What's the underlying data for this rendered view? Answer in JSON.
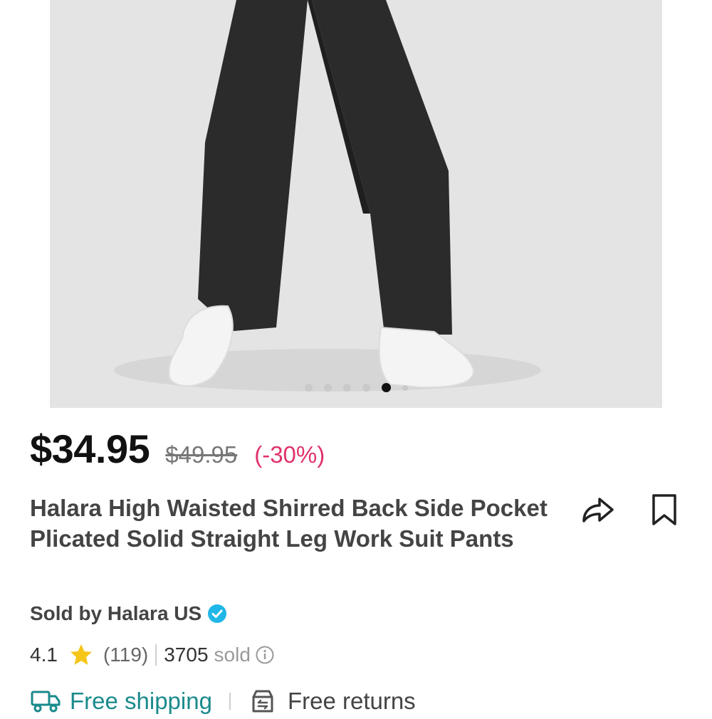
{
  "gallery": {
    "dot_count": 6,
    "active_index": 4
  },
  "price": {
    "current": "$34.95",
    "original": "$49.95",
    "discount": "(-30%)"
  },
  "product": {
    "title": "Halara High Waisted Shirred Back Side Pocket Plicated Solid Straight Leg Work Suit Pants"
  },
  "actions": {
    "share_icon": "share-icon",
    "bookmark_icon": "bookmark-icon"
  },
  "seller": {
    "label": "Sold by Halara US",
    "verified_icon": "verified-badge-icon"
  },
  "rating": {
    "score": "4.1",
    "reviews": "(119)",
    "sold_count": "3705",
    "sold_label": "sold"
  },
  "perks": {
    "shipping": "Free shipping",
    "returns": "Free returns"
  },
  "colors": {
    "discount": "#e0336a",
    "shipping": "#1a8a8c",
    "verified": "#1fb6e8",
    "star": "#f5c518"
  }
}
